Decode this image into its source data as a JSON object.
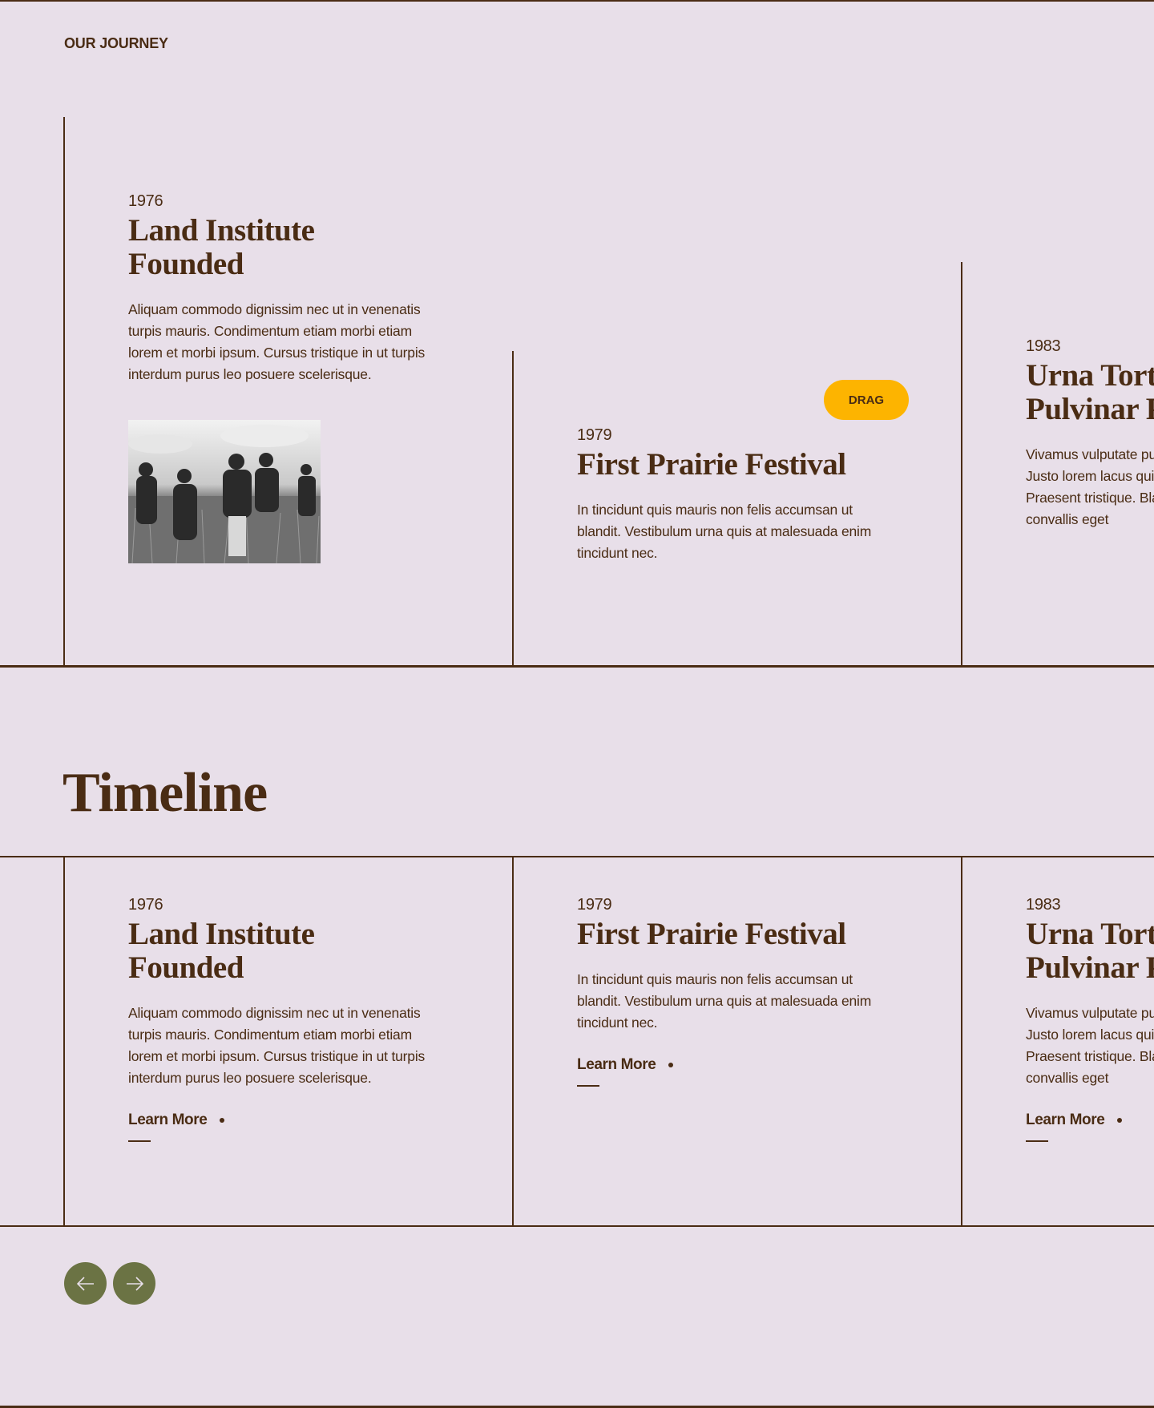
{
  "header": {
    "eyebrow": "OUR JOURNEY"
  },
  "drag_section": {
    "drag_label": "DRAG",
    "cards": [
      {
        "year": "1976",
        "title": "Land Institute Founded",
        "body": "Aliquam commodo dignissim nec ut in venenatis turpis mauris. Condimentum etiam morbi etiam lorem et morbi ipsum. Cursus tristique in ut turpis interdum purus leo posuere scelerisque."
      },
      {
        "year": "1979",
        "title": "First Prairie Festival",
        "body": "In tincidunt quis mauris non felis accumsan ut blandit. Vestibulum urna quis at malesuada enim tincidunt nec."
      },
      {
        "year": "1983",
        "title": "Urna Tortor Pulvinar Pharetra",
        "body": "Vivamus vulputate pulvinar. Justo lorem lacus quis elit at. Praesent tristique. Blandit convallis eget"
      }
    ]
  },
  "timeline": {
    "title": "Timeline",
    "learn_more_label": "Learn More",
    "cards": [
      {
        "year": "1976",
        "title": "Land Institute Founded",
        "body": "Aliquam commodo dignissim nec ut in venenatis turpis mauris. Condimentum etiam morbi etiam lorem et morbi ipsum. Cursus tristique in ut turpis interdum purus leo posuere scelerisque.",
        "link": "Learn More"
      },
      {
        "year": "1979",
        "title": "First Prairie Festival",
        "body": "In tincidunt quis mauris non felis accumsan ut blandit. Vestibulum urna quis at malesuada enim tincidunt nec.",
        "link": "Learn More"
      },
      {
        "year": "1983",
        "title": "Urna Tortor Pulvinar Pharetra",
        "body": "Vivamus vulputate pulvinar. Justo lorem lacus quis elit at. Praesent tristique. Blandit convallis eget",
        "link": "Learn More"
      }
    ],
    "nav": {
      "prev_icon": "arrow-left-icon",
      "next_icon": "arrow-right-icon"
    }
  },
  "colors": {
    "background": "#e8dfe9",
    "text": "#4a2c14",
    "drag": "#fdb400",
    "nav": "#6b7344"
  }
}
